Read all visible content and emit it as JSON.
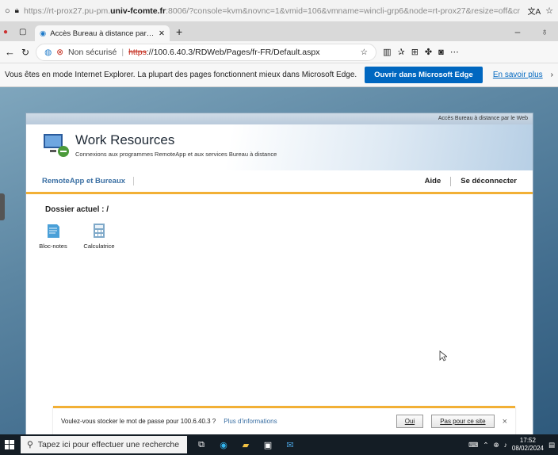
{
  "outer": {
    "url_prefix": "https://rt-prox27.pu-pm.",
    "url_host": "univ-fcomte.fr",
    "url_rest": ":8006/?console=kvm&novnc=1&vmid=106&vmname=wincli-grp6&node=rt-prox27&resize=off&cr"
  },
  "tab": {
    "title": "Accès Bureau à distance par le W"
  },
  "address": {
    "security": "Non sécurisé",
    "scheme": "https",
    "rest": "://100.6.40.3/RDWeb/Pages/fr-FR/Default.aspx"
  },
  "iebar": {
    "message": "Vous êtes en mode Internet Explorer. La plupart des pages fonctionnent mieux dans Microsoft Edge.",
    "open_button": "Ouvrir dans Microsoft Edge",
    "more_link": "En savoir plus"
  },
  "rdweb": {
    "strip_label": "Accès Bureau à distance par le Web",
    "title": "Work Resources",
    "subtitle": "Connexions aux programmes RemoteApp et aux services Bureau à distance",
    "tab_label": "RemoteApp et Bureaux",
    "help": "Aide",
    "logout": "Se déconnecter",
    "folder": "Dossier actuel : /",
    "apps": [
      {
        "label": "Bloc-notes"
      },
      {
        "label": "Calculatrice"
      }
    ]
  },
  "password_bar": {
    "message": "Voulez-vous stocker le mot de passe pour 100.6.40.3 ?",
    "link": "Plus d'informations",
    "yes": "Oui",
    "no": "Pas pour ce site",
    "close": "×"
  },
  "taskbar": {
    "search_placeholder": "Tapez ici pour effectuer une recherche",
    "time": "17:52",
    "date": "08/02/2024"
  }
}
